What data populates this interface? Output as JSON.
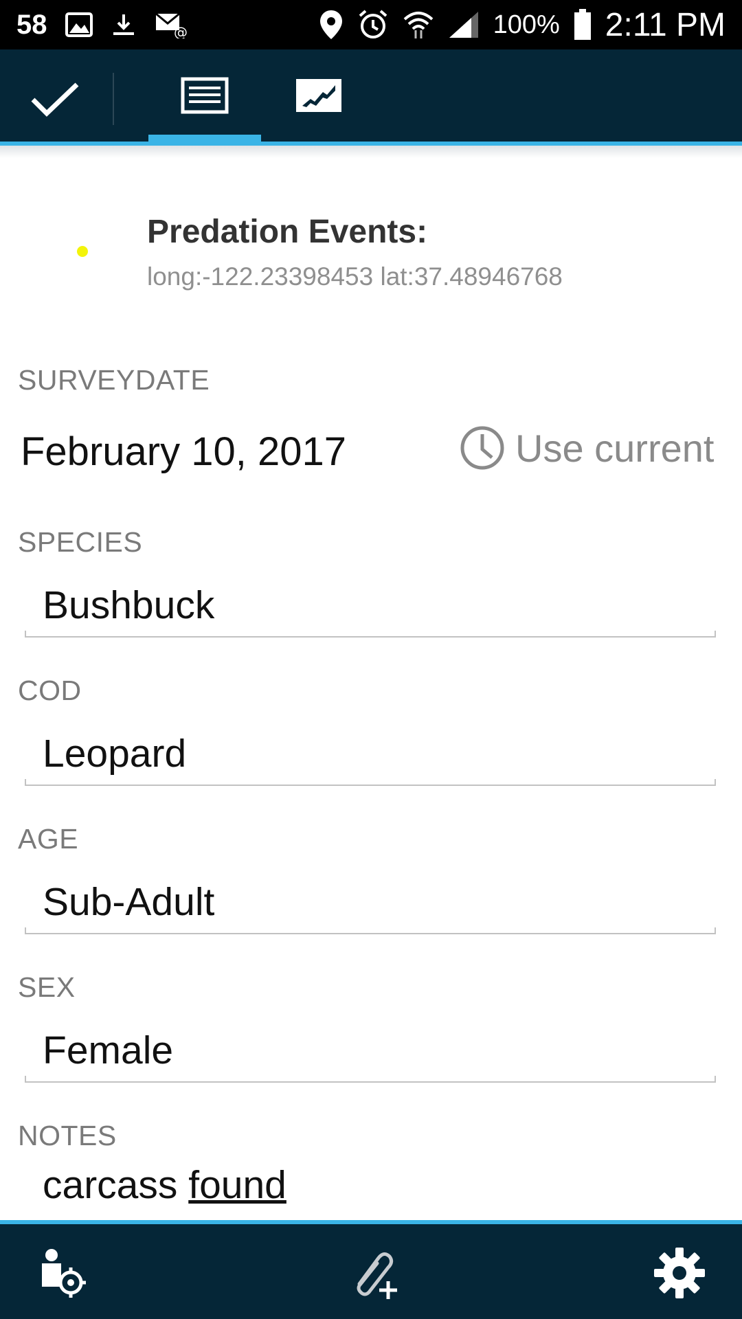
{
  "status_bar": {
    "notification_count": "58",
    "battery_percent": "100%",
    "time": "2:11 PM",
    "icons": [
      "image-icon",
      "download-icon",
      "email-icon",
      "location-icon",
      "alarm-icon",
      "wifi-icon",
      "signal-icon",
      "battery-icon"
    ]
  },
  "action_bar": {
    "done_icon": "check-icon",
    "tabs": [
      {
        "name": "form",
        "icon": "form-icon",
        "selected": true
      },
      {
        "name": "map",
        "icon": "map-icon",
        "selected": false
      }
    ],
    "accent_color": "#3ab4e6",
    "background_color": "#052637"
  },
  "header": {
    "title": "Predation Events:",
    "coordinates": "long:-122.23398453 lat:37.48946768",
    "dot_color": "#f3f40a"
  },
  "fields": {
    "surveydate": {
      "label": "SURVEYDATE",
      "value": "February 10, 2017",
      "use_current": "Use current"
    },
    "species": {
      "label": "SPECIES",
      "value": "Bushbuck"
    },
    "cod": {
      "label": "COD",
      "value": "Leopard"
    },
    "age": {
      "label": "AGE",
      "value": "Sub-Adult"
    },
    "sex": {
      "label": "SEX",
      "value": "Female"
    },
    "notes": {
      "label": "NOTES",
      "value_plain": "carcass ",
      "value_underlined": "found"
    }
  },
  "bottom_bar": {
    "buttons": [
      "locate-user-icon",
      "attach-add-icon",
      "settings-icon"
    ]
  }
}
